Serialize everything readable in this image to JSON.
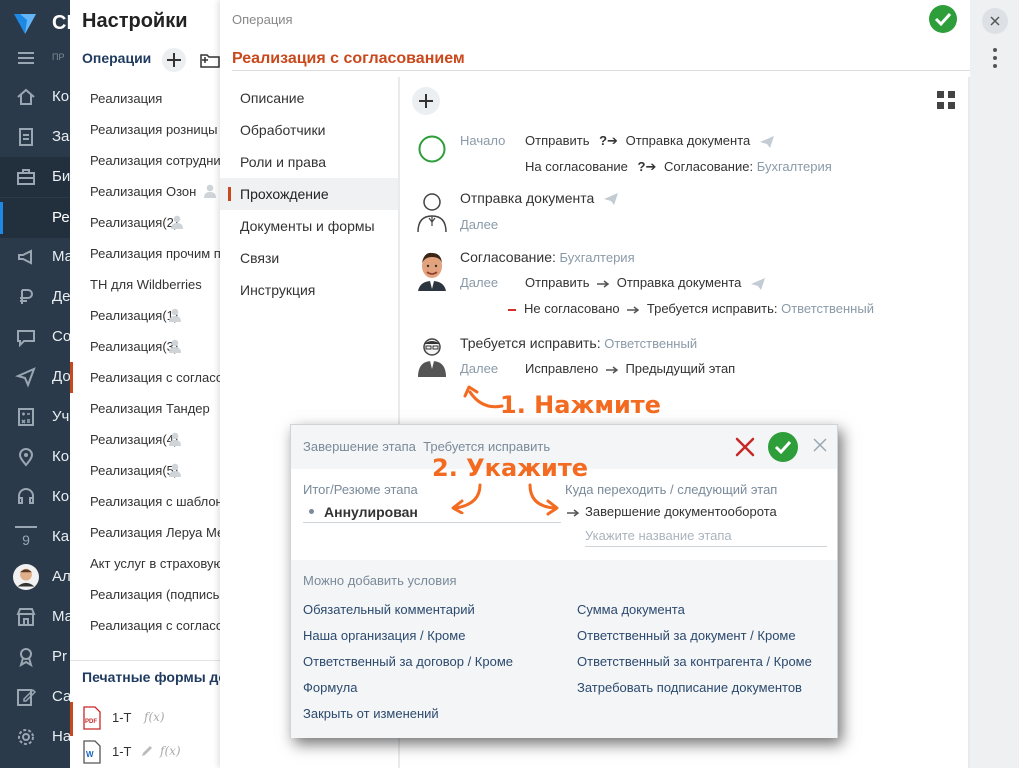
{
  "nav": {
    "brand": "СБ",
    "pr_label": "ПР",
    "items": [
      {
        "label": "Ко",
        "icon": "home-icon"
      },
      {
        "label": "За",
        "icon": "clipboard-icon"
      },
      {
        "label": "Би",
        "icon": "briefcase-icon"
      },
      {
        "label": "Ма",
        "icon": "megaphone-icon"
      },
      {
        "label": "Де",
        "icon": "money-icon"
      },
      {
        "label": "Со",
        "icon": "chat-icon"
      },
      {
        "label": "До",
        "icon": "send-icon"
      },
      {
        "label": "Уч",
        "icon": "calculator-icon"
      },
      {
        "label": "Ко",
        "icon": "map-pin-icon"
      },
      {
        "label": "Ко",
        "icon": "headset-icon"
      },
      {
        "label": "Ка",
        "icon": "calendar-icon"
      },
      {
        "label": "Ал",
        "icon": "avatar"
      },
      {
        "label": "Ма",
        "icon": "store-icon"
      },
      {
        "label": "Pr",
        "icon": "award-icon"
      },
      {
        "label": "Са",
        "icon": "edit-icon"
      },
      {
        "label": "На",
        "icon": "gear-icon"
      }
    ],
    "calendar_day": "9",
    "sub_label": "Ре"
  },
  "settings": {
    "title": "Настройки",
    "ops_heading": "Операции",
    "operations": [
      {
        "label": "Реализация",
        "person": false
      },
      {
        "label": "Реализация розницы",
        "person": false
      },
      {
        "label": "Реализация сотрудни",
        "person": false
      },
      {
        "label": "Реализация Озон",
        "person": true
      },
      {
        "label": "Реализация(2)",
        "person": true
      },
      {
        "label": "Реализация прочим п",
        "person": false
      },
      {
        "label": "ТН для Wildberries",
        "person": false
      },
      {
        "label": "Реализация(1)",
        "person": true
      },
      {
        "label": "Реализация(3)",
        "person": true
      },
      {
        "label": "Реализация с согласо",
        "person": false,
        "selected": true
      },
      {
        "label": "Реализация Тандер",
        "person": false
      },
      {
        "label": "Реализация(4)",
        "person": true
      },
      {
        "label": "Реализация(5)",
        "person": true
      },
      {
        "label": "Реализация с шаблон",
        "person": false
      },
      {
        "label": "Реализация Леруа Ме",
        "person": false
      },
      {
        "label": "Акт услуг в страховую",
        "person": false
      },
      {
        "label": "Реализация (подпись",
        "person": false
      },
      {
        "label": "Реализация с согласо",
        "person": false
      }
    ],
    "print_heading": "Печатные формы док",
    "print_forms": [
      {
        "label": "1-Т",
        "fx": "f(x)",
        "type": "PDF"
      },
      {
        "label": "1-Т",
        "fx": "f(x)",
        "type": "W"
      }
    ]
  },
  "operation": {
    "small_label": "Операция",
    "title": "Реализация с согласованием",
    "tabs": [
      "Описание",
      "Обработчики",
      "Роли и права",
      "Прохождение",
      "Документы и формы",
      "Связи",
      "Инструкция"
    ],
    "active_tab": "Прохождение",
    "stages": {
      "start": {
        "name": "Начало",
        "row1": {
          "action": "Отправить",
          "q": "?",
          "target": "Отправка документа"
        },
        "row2": {
          "action": "На согласование",
          "q": "?",
          "target": "Согласование:",
          "target_role": "Бухгалтерия"
        }
      },
      "send": {
        "name": "Отправка документа",
        "next": "Далее"
      },
      "approve": {
        "name": "Согласование:",
        "role": "Бухгалтерия",
        "next": "Далее",
        "row1": {
          "action": "Отправить",
          "target": "Отправка документа"
        },
        "row2": {
          "action": "Не согласовано",
          "target": "Требуется исправить:",
          "target_role": "Ответственный"
        }
      },
      "fix": {
        "name": "Требуется исправить:",
        "role": "Ответственный",
        "next": "Далее",
        "row1": {
          "action": "Исправлено",
          "target": "Предыдущий этап"
        }
      }
    }
  },
  "popup": {
    "title_prefix": "Завершение этапа",
    "title_stage": "Требуется исправить",
    "result_label": "Итог/Резюме этапа",
    "result_value": "Аннулирован",
    "next_label": "Куда переходить / следующий этап",
    "next_value": "Завершение документооборота",
    "next_placeholder": "Укажите название этапа",
    "conditions_title": "Можно добавить условия",
    "conditions_left": [
      "Обязательный комментарий",
      "Наша организация / Кроме",
      "Ответственный за договор / Кроме",
      "Формула",
      "Закрыть от изменений"
    ],
    "conditions_right": [
      "Сумма документа",
      "Ответственный за документ / Кроме",
      "Ответственный за контрагента / Кроме",
      "Затребовать подписание документов"
    ]
  },
  "annotations": {
    "step1": "1. Нажмите",
    "step2": "2. Укажите"
  },
  "colors": {
    "accent": "#c9491c",
    "ok_green": "#2e9e3a",
    "annotation": "#f26b21",
    "nav_bg": "#2b3a4a"
  }
}
